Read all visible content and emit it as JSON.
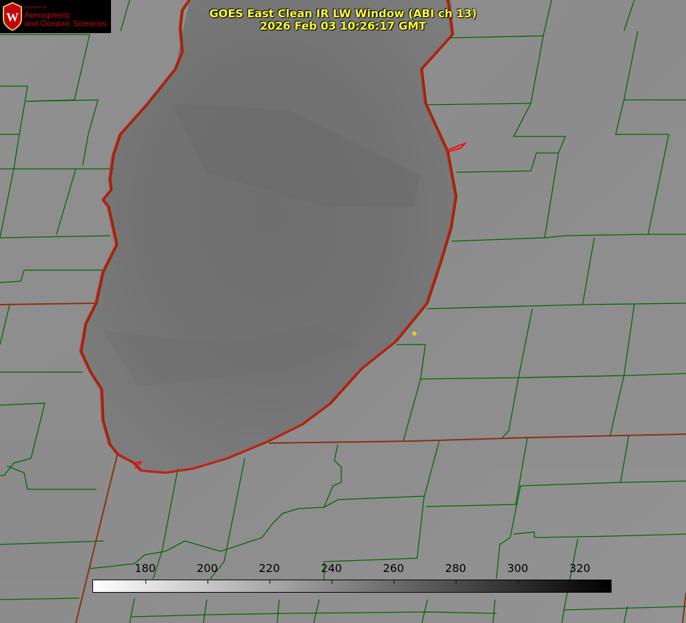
{
  "title": {
    "line1": "GOES East Clean IR LW Window (ABI ch 13)",
    "line2": "2026 Feb 03 10:26:17 GMT"
  },
  "logo": {
    "department": "Department of",
    "line1": "Atmospheric",
    "line2": "and Oceanic Sciences"
  },
  "colorbar": {
    "ticks": [
      "180",
      "200",
      "220",
      "240",
      "260",
      "280",
      "300",
      "320"
    ],
    "range": [
      163,
      330
    ],
    "color_low": "#ffffff",
    "color_high": "#000000"
  },
  "colors": {
    "state_borders": "#006600",
    "coastline": "#ee1111",
    "title_text": "#ffff33",
    "marker": "#e8d020"
  }
}
